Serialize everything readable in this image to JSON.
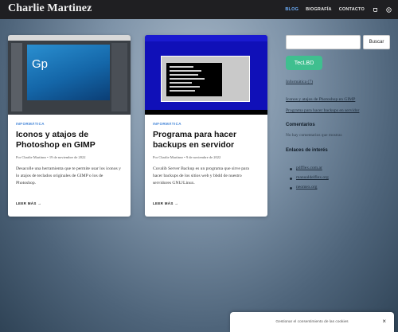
{
  "site": {
    "title": "Charlie Martinez"
  },
  "nav": {
    "items": [
      {
        "label": "BLOG",
        "active": true
      },
      {
        "label": "BIOGRAFÍA",
        "active": false
      },
      {
        "label": "CONTACTO",
        "active": false
      }
    ],
    "icons": [
      "mastodon-icon",
      "github-icon"
    ]
  },
  "posts": [
    {
      "category": "INFORMÁTICA",
      "title": "Iconos y atajos de Photoshop en GIMP",
      "meta": "Por Charlie Martínez • 19 de noviembre de 2022",
      "excerpt": "Desacolle una herramienta que te permite usar los iconos y lo atajos de teclados originales de GIMP o los de Photoshop.",
      "readmore": "LEER MÁS →",
      "thumb_text": "Gp"
    },
    {
      "category": "INFORMÁTICA",
      "title": "Programa para hacer backups en servidor",
      "meta": "Por Charlie Martínez • 9 de noviembre de 2022",
      "excerpt": "Cuvalib Server Backup es un programa que sirve para hacer backups de los sitios web y bbdd de nuestro servidores GNU/Linux.",
      "readmore": "LEER MÁS →"
    }
  ],
  "sidebar": {
    "search_placeholder": "",
    "search_button": "Buscar",
    "badge": "TecLBD",
    "links_top": [
      "Informática (7)"
    ],
    "links_recent": [
      "Iconos y atajos de Photoshop en GIMP",
      "Programa para hacer backups en servidor"
    ],
    "comments_heading": "Comentarios",
    "comments_text": "No hay comentarios que mostrar.",
    "links_heading": "Enlaces de interés",
    "links": [
      "pdfflex.com.ar",
      "manualdelflex.org",
      "neomex.org"
    ]
  },
  "cookie": {
    "text": "Gestionar el consentimiento de las cookies",
    "close": "×"
  },
  "colors": {
    "accent": "#3a7fd6",
    "nav_active": "#6fb1ff",
    "badge": "#3fbf8f"
  }
}
